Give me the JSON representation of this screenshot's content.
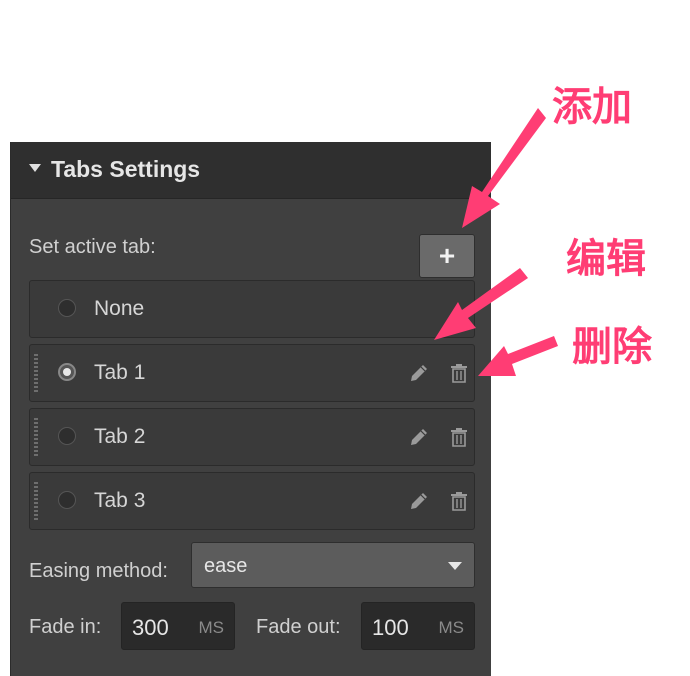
{
  "panel": {
    "title": "Tabs Settings",
    "set_active_label": "Set active tab:",
    "add_button": "+",
    "rows": [
      {
        "label": "None",
        "checked": false,
        "draggable": false,
        "editable": false
      },
      {
        "label": "Tab 1",
        "checked": true,
        "draggable": true,
        "editable": true
      },
      {
        "label": "Tab 2",
        "checked": false,
        "draggable": true,
        "editable": true
      },
      {
        "label": "Tab 3",
        "checked": false,
        "draggable": true,
        "editable": true
      }
    ],
    "easing_label": "Easing method:",
    "easing_value": "ease",
    "fade_in_label": "Fade in:",
    "fade_in_value": "300",
    "fade_in_unit": "MS",
    "fade_out_label": "Fade out:",
    "fade_out_value": "100",
    "fade_out_unit": "MS"
  },
  "annotations": {
    "add": "添加",
    "edit": "编辑",
    "delete": "删除",
    "color": "#ff3d74"
  },
  "icons": {
    "collapse": "caret-down-icon",
    "add": "plus-icon",
    "edit": "pencil-icon",
    "delete": "trash-icon",
    "drag": "drag-handle-icon"
  }
}
